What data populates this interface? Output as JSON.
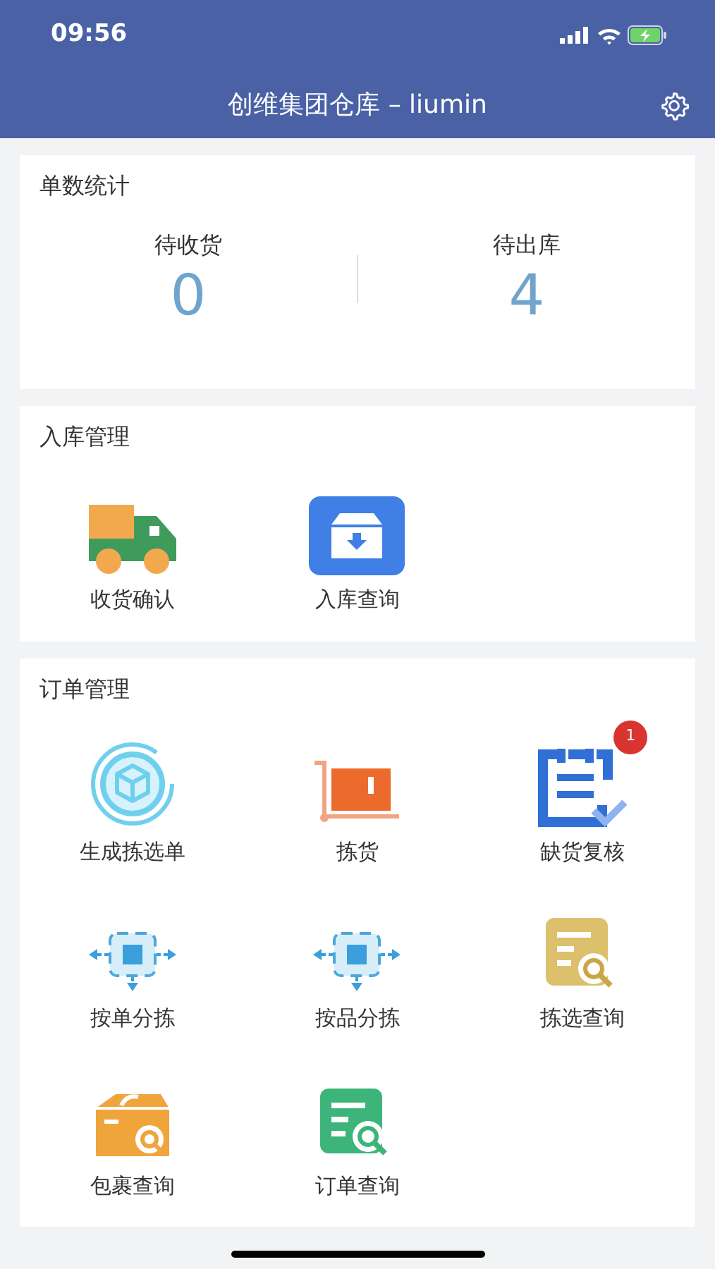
{
  "status_bar": {
    "time": "09:56"
  },
  "header": {
    "title": "创维集团仓库 – liumin"
  },
  "stats": {
    "title": "单数统计",
    "items": [
      {
        "label": "待收货",
        "value": "0"
      },
      {
        "label": "待出库",
        "value": "4"
      }
    ]
  },
  "sections": [
    {
      "title": "入库管理",
      "items": [
        {
          "label": "收货确认"
        },
        {
          "label": "入库查询"
        }
      ]
    },
    {
      "title": "订单管理",
      "items": [
        {
          "label": "生成拣选单"
        },
        {
          "label": "拣货"
        },
        {
          "label": "缺货复核",
          "badge": "1"
        },
        {
          "label": "按单分拣"
        },
        {
          "label": "按品分拣"
        },
        {
          "label": "拣选查询"
        },
        {
          "label": "包裹查询"
        },
        {
          "label": "订单查询"
        }
      ]
    }
  ]
}
